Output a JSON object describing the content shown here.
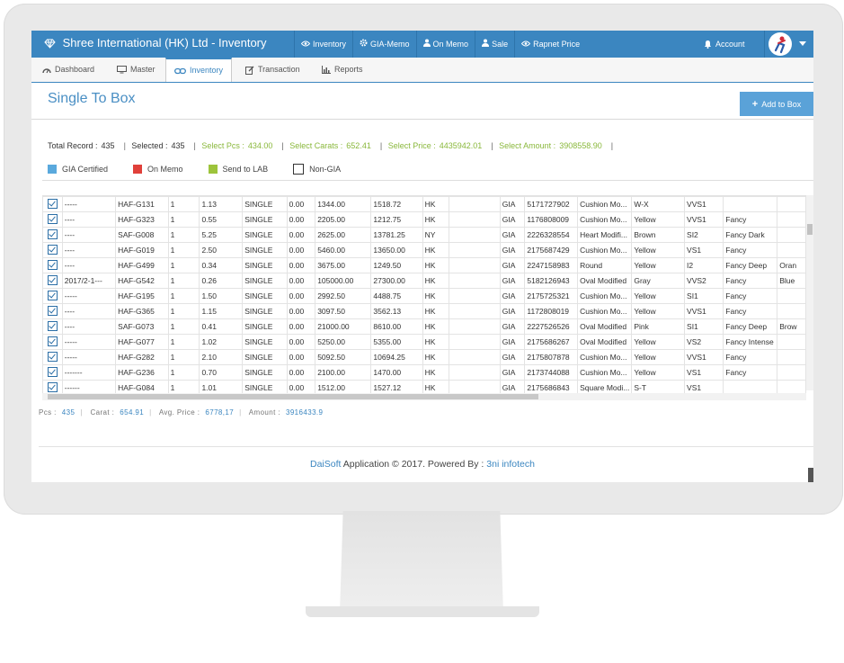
{
  "app": {
    "title": "Shree International (HK) Ltd - Inventory",
    "accent": "#3b86c0"
  },
  "topmenu": [
    {
      "label": "Inventory",
      "icon": "eye-icon"
    },
    {
      "label": "GIA-Memo",
      "icon": "gear-icon"
    },
    {
      "label": "On Memo",
      "icon": "user-icon"
    },
    {
      "label": "Sale",
      "icon": "user-icon"
    },
    {
      "label": "Rapnet Price",
      "icon": "eye-icon"
    }
  ],
  "account_label": "Account",
  "tabs": [
    {
      "label": "Dashboard",
      "icon": "dashboard-icon"
    },
    {
      "label": "Master",
      "icon": "monitor-icon"
    },
    {
      "label": "Inventory",
      "icon": "link-icon"
    },
    {
      "label": "Transaction",
      "icon": "edit-icon"
    },
    {
      "label": "Reports",
      "icon": "bar-chart-icon"
    }
  ],
  "page": {
    "title": "Single To Box",
    "add_button": "Add to Box"
  },
  "stats": {
    "total_record_label": "Total Record :",
    "total_record": "435",
    "selected_label": "Selected :",
    "selected": "435",
    "select_pcs_label": "Select Pcs :",
    "select_pcs": "434.00",
    "select_carats_label": "Select Carats :",
    "select_carats": "652.41",
    "select_price_label": "Select Price :",
    "select_price": "4435942.01",
    "select_amount_label": "Select Amount :",
    "select_amount": "3908558.90"
  },
  "legend": [
    {
      "label": "GIA Certified",
      "color": "#5aa9dd"
    },
    {
      "label": "On Memo",
      "color": "#e0403a"
    },
    {
      "label": "Send to LAB",
      "color": "#9dc43b"
    },
    {
      "label": "Non-GIA",
      "color": "#ffffff"
    }
  ],
  "grid": {
    "rows": [
      [
        "-----",
        "HAF-G131",
        "1",
        "1.13",
        "SINGLE",
        "0.00",
        "1344.00",
        "1518.72",
        "HK",
        "",
        "GIA",
        "5171727902",
        "Cushion Mo...",
        "W-X",
        "VVS1",
        "",
        ""
      ],
      [
        "----",
        "HAF-G323",
        "1",
        "0.55",
        "SINGLE",
        "0.00",
        "2205.00",
        "1212.75",
        "HK",
        "",
        "GIA",
        "1176808009",
        "Cushion Mo...",
        "Yellow",
        "VVS1",
        "Fancy",
        ""
      ],
      [
        "----",
        "SAF-G008",
        "1",
        "5.25",
        "SINGLE",
        "0.00",
        "2625.00",
        "13781.25",
        "NY",
        "",
        "GIA",
        "2226328554",
        "Heart Modifi...",
        "Brown",
        "SI2",
        "Fancy Dark",
        ""
      ],
      [
        "----",
        "HAF-G019",
        "1",
        "2.50",
        "SINGLE",
        "0.00",
        "5460.00",
        "13650.00",
        "HK",
        "",
        "GIA",
        "2175687429",
        "Cushion Mo...",
        "Yellow",
        "VS1",
        "Fancy",
        ""
      ],
      [
        "----",
        "HAF-G499",
        "1",
        "0.34",
        "SINGLE",
        "0.00",
        "3675.00",
        "1249.50",
        "HK",
        "",
        "GIA",
        "2247158983",
        "Round",
        "Yellow",
        "I2",
        "Fancy Deep",
        "Oran"
      ],
      [
        "2017/2-1---",
        "HAF-G542",
        "1",
        "0.26",
        "SINGLE",
        "0.00",
        "105000.00",
        "27300.00",
        "HK",
        "",
        "GIA",
        "5182126943",
        "Oval Modified",
        "Gray",
        "VVS2",
        "Fancy",
        "Blue"
      ],
      [
        "-----",
        "HAF-G195",
        "1",
        "1.50",
        "SINGLE",
        "0.00",
        "2992.50",
        "4488.75",
        "HK",
        "",
        "GIA",
        "2175725321",
        "Cushion Mo...",
        "Yellow",
        "SI1",
        "Fancy",
        ""
      ],
      [
        "----",
        "HAF-G365",
        "1",
        "1.15",
        "SINGLE",
        "0.00",
        "3097.50",
        "3562.13",
        "HK",
        "",
        "GIA",
        "1172808019",
        "Cushion Mo...",
        "Yellow",
        "VVS1",
        "Fancy",
        ""
      ],
      [
        "----",
        "SAF-G073",
        "1",
        "0.41",
        "SINGLE",
        "0.00",
        "21000.00",
        "8610.00",
        "HK",
        "",
        "GIA",
        "2227526526",
        "Oval Modified",
        "Pink",
        "SI1",
        "Fancy Deep",
        "Brow"
      ],
      [
        "-----",
        "HAF-G077",
        "1",
        "1.02",
        "SINGLE",
        "0.00",
        "5250.00",
        "5355.00",
        "HK",
        "",
        "GIA",
        "2175686267",
        "Oval Modified",
        "Yellow",
        "VS2",
        "Fancy Intense",
        ""
      ],
      [
        "-----",
        "HAF-G282",
        "1",
        "2.10",
        "SINGLE",
        "0.00",
        "5092.50",
        "10694.25",
        "HK",
        "",
        "GIA",
        "2175807878",
        "Cushion Mo...",
        "Yellow",
        "VVS1",
        "Fancy",
        ""
      ],
      [
        "-------",
        "HAF-G236",
        "1",
        "0.70",
        "SINGLE",
        "0.00",
        "2100.00",
        "1470.00",
        "HK",
        "",
        "GIA",
        "2173744088",
        "Cushion Mo...",
        "Yellow",
        "VS1",
        "Fancy",
        ""
      ],
      [
        "------",
        "HAF-G084",
        "1",
        "1.01",
        "SINGLE",
        "0.00",
        "1512.00",
        "1527.12",
        "HK",
        "",
        "GIA",
        "2175686843",
        "Square Modi...",
        "S-T",
        "VS1",
        "",
        ""
      ]
    ]
  },
  "footer_stats": {
    "pcs_label": "Pcs :",
    "pcs": "435",
    "carat_label": "Carat :",
    "carat": "654.91",
    "avg_price_label": "Avg. Price :",
    "avg_price": "6778,17",
    "amount_label": "Amount :",
    "amount": "3916433.9"
  },
  "copyright": {
    "brand": "DaiSoft",
    "text": " Application © 2017. Powered By : ",
    "company": "3ni infotech"
  }
}
